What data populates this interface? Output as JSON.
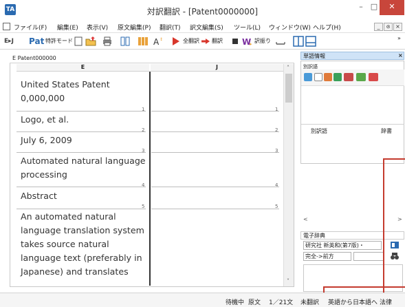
{
  "window": {
    "app_icon": "TA",
    "title": "対訳翻訳 - [Patent0000000]",
    "min": "–",
    "max": "□",
    "close": "✕"
  },
  "menu": {
    "items": [
      "ファイル(F)",
      "編集(E)",
      "表示(V)",
      "原文編集(P)",
      "翻訳(T)",
      "訳文編集(S)",
      "ツール(L)",
      "ウィンドウ(W)",
      "ヘルプ(H)"
    ],
    "mdi_min": "_",
    "mdi_restore": "ɞ",
    "mdi_close": "×"
  },
  "toolbar": {
    "ej_label": "E▸J",
    "pat_label": "Pat",
    "patent_mode": "特許モード",
    "translate_all": "全翻訳",
    "translate": "翻訳",
    "kunfuri": "訳振り"
  },
  "document": {
    "tab_label": "E  Patent000000",
    "col_e": "E",
    "col_j": "J",
    "segments": [
      {
        "text": "United States Patent 0,000,000",
        "num": "1"
      },
      {
        "text": "Logo, et al.",
        "num": "2"
      },
      {
        "text": "July 6, 2009",
        "num": "3"
      },
      {
        "text": "Automated natural language processing",
        "num": "4"
      },
      {
        "text": "Abstract",
        "num": "5"
      },
      {
        "text": "An automated natural language translation system takes source natural language text (preferably in Japanese) and translates",
        "num": ""
      }
    ]
  },
  "word_panel": {
    "title": "単語情報",
    "close": "×",
    "sub_label": "別訳語",
    "col_alt": "別訳語",
    "col_dict": "辞書"
  },
  "dict_panel": {
    "title": "電子辞典",
    "dictionary": "研究社 新英和(第7版)・",
    "search_mode": "完全->前方"
  },
  "status": {
    "state": "待機中",
    "source": "原文",
    "position": "1／21文",
    "untranslated": "未翻訳",
    "direction": "英語から日本語へ",
    "field": "法律"
  }
}
